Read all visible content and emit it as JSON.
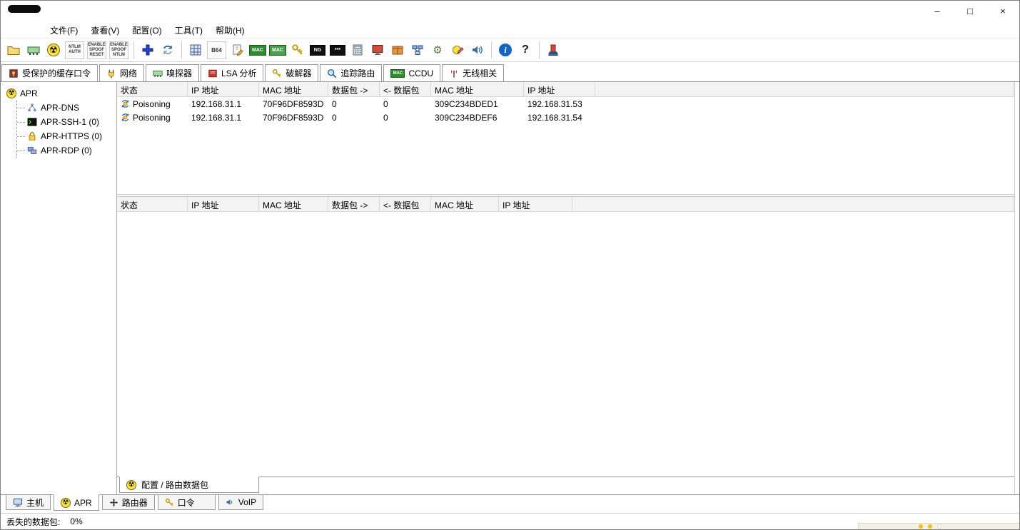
{
  "colors": {
    "accent_yellow": "#ffe14d",
    "header_bg": "#f3f3f3",
    "border_gray": "#9a9a9a",
    "mac_green": "#2e8b2e",
    "info_blue": "#1565c0"
  },
  "icons": {
    "radioactive": "☢",
    "gear": "⚙",
    "info": "i",
    "help": "?"
  },
  "window": {
    "controls": {
      "minimize": "–",
      "maximize": "□",
      "close": "×"
    }
  },
  "menubar": {
    "items": [
      "文件(F)",
      "查看(V)",
      "配置(O)",
      "工具(T)",
      "帮助(H)"
    ]
  },
  "toolbar": {
    "icons": [
      {
        "name": "open-file"
      },
      {
        "name": "start-stop-sniffer"
      },
      {
        "name": "start-stop-apr"
      },
      {
        "name": "ntlm-auth",
        "text": "NTLM\nAUTH"
      },
      {
        "name": "spoof-reset",
        "text": "ENABLE\nSPOOF\nRESET"
      },
      {
        "name": "spoof-ntlm",
        "text": "ENABLE\nSPOOF\nNTLM"
      },
      {
        "name": "add-entry"
      },
      {
        "name": "refresh"
      },
      {
        "name": "base-converter"
      },
      {
        "name": "base64-decoder",
        "text": "B64"
      },
      {
        "name": "notes-editor"
      },
      {
        "name": "mac-scanner",
        "text": "MAC"
      },
      {
        "name": "mac-tool",
        "text": "MAC"
      },
      {
        "name": "key-tool"
      },
      {
        "name": "ng-hash",
        "text": "NG"
      },
      {
        "name": "password-stars",
        "text": "***"
      },
      {
        "name": "hash-calculator"
      },
      {
        "name": "remote-screen"
      },
      {
        "name": "crate-tool"
      },
      {
        "name": "network-shares"
      },
      {
        "name": "services-gear"
      },
      {
        "name": "registry-editor"
      },
      {
        "name": "voip-speaker"
      },
      {
        "name": "info"
      },
      {
        "name": "help"
      },
      {
        "name": "exit"
      }
    ]
  },
  "top_tabs": {
    "tabs": [
      {
        "label": "受保护的缓存口令"
      },
      {
        "label": "网络"
      },
      {
        "label": "嗅探器"
      },
      {
        "label": "LSA 分析"
      },
      {
        "label": "破解器"
      },
      {
        "label": "追踪路由"
      },
      {
        "label": "CCDU"
      },
      {
        "label": "无线相关"
      }
    ]
  },
  "sidebar": {
    "items": [
      {
        "label": "APR"
      },
      {
        "label": "APR-DNS"
      },
      {
        "label": "APR-SSH-1 (0)"
      },
      {
        "label": "APR-HTTPS (0)"
      },
      {
        "label": "APR-RDP (0)"
      }
    ]
  },
  "apr_table": {
    "columns": [
      "状态",
      "IP 地址",
      "MAC 地址",
      "数据包 ->",
      "<- 数据包",
      "MAC 地址",
      "IP 地址"
    ],
    "rows": [
      [
        "Poisoning",
        "192.168.31.1",
        "70F96DF8593D",
        "0",
        "0",
        "309C234BDED1",
        "192.168.31.53"
      ],
      [
        "Poisoning",
        "192.168.31.1",
        "70F96DF8593D",
        "0",
        "0",
        "309C234BDEF6",
        "192.168.31.54"
      ]
    ]
  },
  "lower_table": {
    "columns": [
      "状态",
      "IP 地址",
      "MAC 地址",
      "数据包 ->",
      "<- 数据包",
      "MAC 地址",
      "IP 地址"
    ]
  },
  "inner_tab": {
    "label": "配置 / 路由数据包"
  },
  "bottom_tabs": {
    "tabs": [
      {
        "label": "主机"
      },
      {
        "label": "APR"
      },
      {
        "label": "路由器"
      },
      {
        "label": "口令"
      },
      {
        "label": "VoIP"
      }
    ]
  },
  "statusbar": {
    "label": "丢失的数据包:",
    "value": "0%"
  }
}
